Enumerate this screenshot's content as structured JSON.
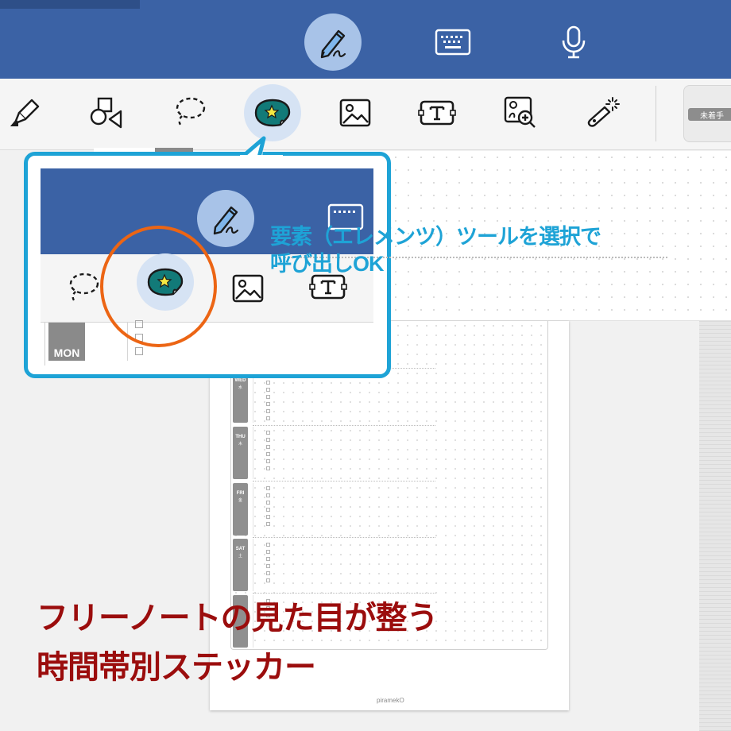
{
  "top_bar": {
    "modes": [
      {
        "icon": "pen-icon",
        "active": true
      },
      {
        "icon": "keyboard-icon",
        "active": false
      },
      {
        "icon": "microphone-icon",
        "active": false
      }
    ]
  },
  "toolbar": {
    "tools": [
      {
        "icon": "highlighter-icon"
      },
      {
        "icon": "shapes-icon"
      },
      {
        "icon": "lasso-icon"
      },
      {
        "icon": "sticker-element-icon",
        "active": true
      },
      {
        "icon": "image-icon"
      },
      {
        "icon": "text-box-icon"
      },
      {
        "icon": "image-search-icon"
      },
      {
        "icon": "laser-pointer-icon"
      }
    ],
    "tag_label": "未着手"
  },
  "callout": {
    "line1": "要素（エレメンツ）ツールを選択で",
    "line2": "呼び出しOK",
    "mon_label": "MON",
    "color": "#1ea3d6",
    "ring_color": "#ec6514"
  },
  "planner": {
    "days": [
      {
        "en": "WED",
        "jp": "水"
      },
      {
        "en": "THU",
        "jp": "木"
      },
      {
        "en": "FRI",
        "jp": "金"
      },
      {
        "en": "SAT",
        "jp": "土"
      }
    ],
    "brand": "piramekO"
  },
  "headline": {
    "line1": "フリーノートの見た目が整う",
    "line2": "時間帯別ステッカー",
    "color": "#9b0d0d"
  },
  "colors": {
    "navy": "#3b62a5",
    "active_mode_bg": "#a8c3e8",
    "sticker_teal": "#127a78",
    "star_yellow": "#f4e842"
  }
}
